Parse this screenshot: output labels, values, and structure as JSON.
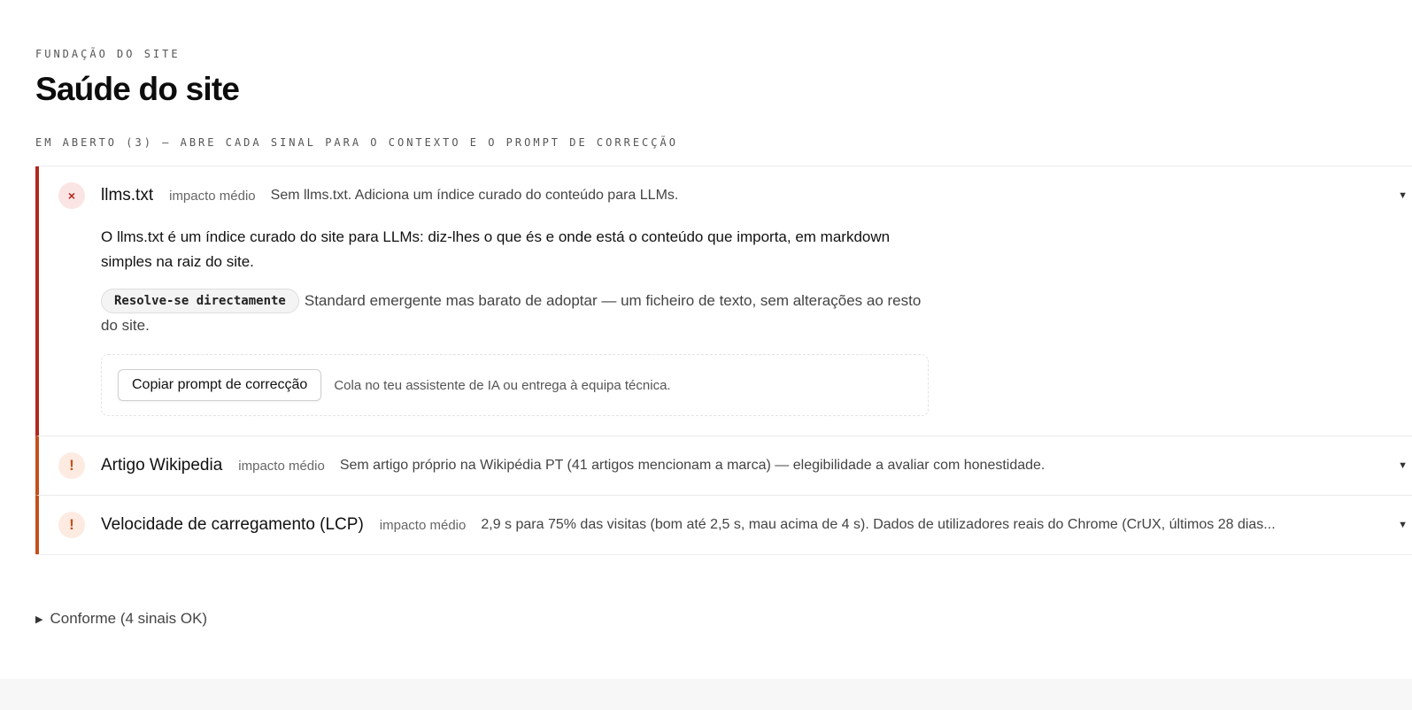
{
  "header": {
    "eyebrow": "FUNDAÇÃO DO SITE",
    "title": "Saúde do site"
  },
  "open_section": {
    "label": "EM ABERTO (3) — ABRE CADA SINAL PARA O CONTEXTO E O PROMPT DE CORRECÇÃO"
  },
  "issues": [
    {
      "status": "error",
      "status_glyph": "×",
      "status_icon": "x-icon",
      "title": "llms.txt",
      "impact": "impacto médio",
      "summary": "Sem llms.txt. Adiciona um índice curado do conteúdo para LLMs.",
      "expanded": true,
      "body_text": "O llms.txt é um índice curado do site para LLMs: diz-lhes o que és e onde está o conteúdo que importa, em markdown simples na raiz do site.",
      "resolve_chip": "Resolve-se directamente",
      "resolve_text": "Standard emergente mas barato de adoptar — um ficheiro de texto, sem alterações ao resto do site.",
      "copy_button": "Copiar prompt de correcção",
      "copy_hint": "Cola no teu assistente de IA ou entrega à equipa técnica."
    },
    {
      "status": "warning",
      "status_glyph": "!",
      "status_icon": "exclamation-icon",
      "title": "Artigo Wikipedia",
      "impact": "impacto médio",
      "summary": "Sem artigo próprio na Wikipédia PT (41 artigos mencionam a marca) — elegibilidade a avaliar com honestidade.",
      "expanded": false
    },
    {
      "status": "warning",
      "status_glyph": "!",
      "status_icon": "exclamation-icon",
      "title": "Velocidade de carregamento (LCP)",
      "impact": "impacto médio",
      "summary": "2,9 s para 75% das visitas (bom até 2,5 s, mau acima de 4 s). Dados de utilizadores reais do Chrome (CrUX, últimos 28 dias...",
      "expanded": false
    }
  ],
  "chevron_glyph": "▼",
  "conforme": {
    "glyph": "▶",
    "label": "Conforme (4 sinais OK)"
  },
  "colors": {
    "error_accent": "#b3261e",
    "warning_accent": "#c4501c"
  }
}
